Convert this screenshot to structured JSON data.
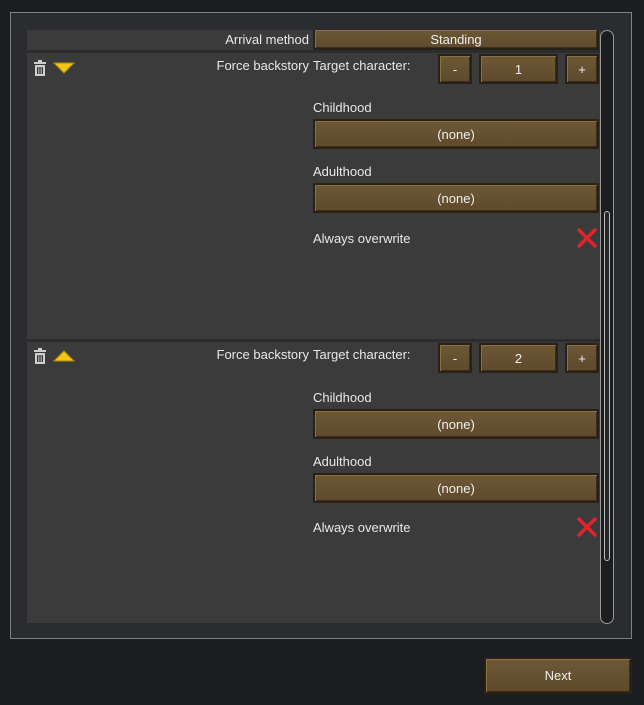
{
  "arrival": {
    "label": "Arrival method",
    "value": "Standing"
  },
  "entries": [
    {
      "title": "Force backstory",
      "target_label": "Target character:",
      "minus_label": "-",
      "target_value": "1",
      "plus_label": "+",
      "childhood_label": "Childhood",
      "childhood_value": "(none)",
      "adulthood_label": "Adulthood",
      "adulthood_value": "(none)",
      "overwrite_label": "Always overwrite",
      "overwrite_checked": false,
      "expand_icon": "chevron-down-icon"
    },
    {
      "title": "Force backstory",
      "target_label": "Target character:",
      "minus_label": "-",
      "target_value": "2",
      "plus_label": "+",
      "childhood_label": "Childhood",
      "childhood_value": "(none)",
      "adulthood_label": "Adulthood",
      "adulthood_value": "(none)",
      "overwrite_label": "Always overwrite",
      "overwrite_checked": false,
      "expand_icon": "chevron-up-icon"
    }
  ],
  "footer": {
    "next_label": "Next"
  },
  "colors": {
    "button": "#6d5836",
    "panel": "#3b3b3b",
    "background": "#1b1d20",
    "check_off": "#e0242a",
    "arrow": "#f2c416"
  }
}
